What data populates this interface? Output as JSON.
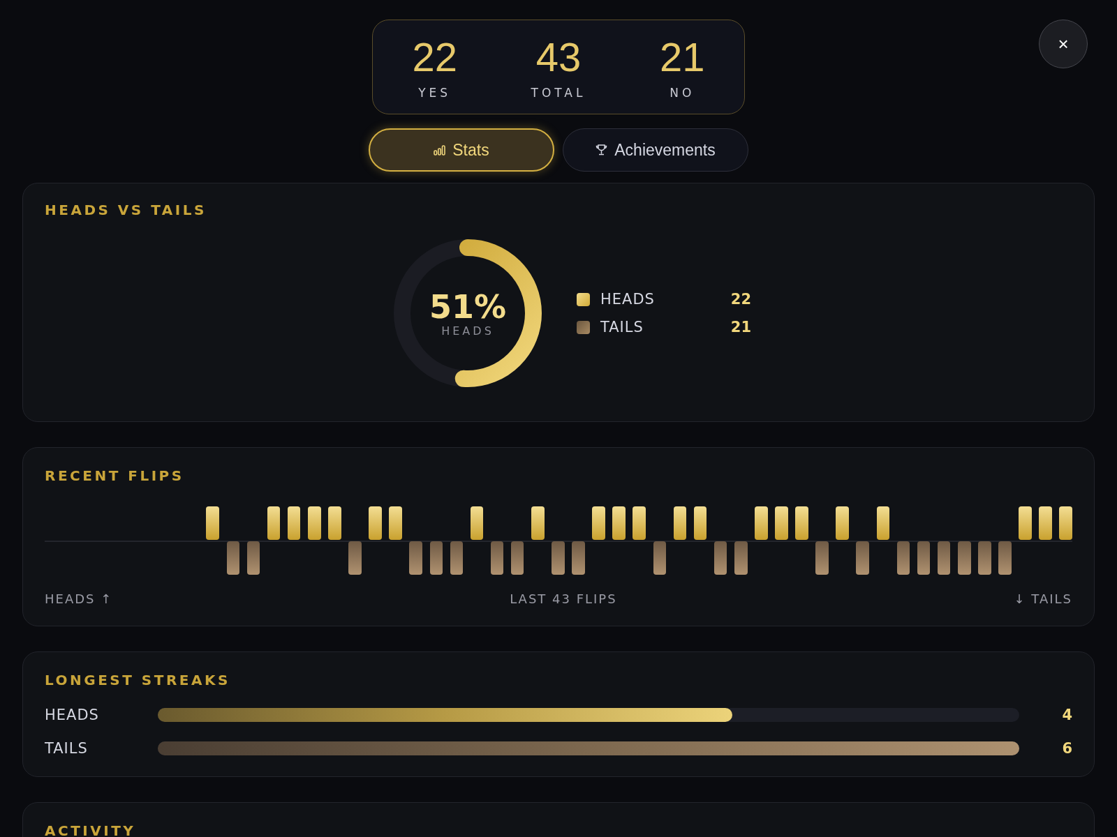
{
  "summary": [
    {
      "value": "22",
      "label": "YES"
    },
    {
      "value": "43",
      "label": "TOTAL"
    },
    {
      "value": "21",
      "label": "NO"
    }
  ],
  "tabs": [
    {
      "label": "Stats",
      "selected": true
    },
    {
      "label": "Achievements",
      "selected": false
    }
  ],
  "close": {
    "label": "×"
  },
  "heads_vs_tails": {
    "title": "HEADS VS TAILS",
    "donut": {
      "level": 0.51,
      "value": "51%",
      "caption": "HEADS"
    },
    "legend": [
      {
        "kind": "heads",
        "label": "HEADS",
        "count": "22"
      },
      {
        "kind": "tails",
        "label": "TAILS",
        "count": "21"
      }
    ]
  },
  "recent_flips": {
    "title": "RECENT FLIPS",
    "flips": [
      {
        "kind": "heads"
      },
      {
        "kind": "tails"
      },
      {
        "kind": "tails"
      },
      {
        "kind": "heads"
      },
      {
        "kind": "heads"
      },
      {
        "kind": "heads"
      },
      {
        "kind": "heads"
      },
      {
        "kind": "tails"
      },
      {
        "kind": "heads"
      },
      {
        "kind": "heads"
      },
      {
        "kind": "tails"
      },
      {
        "kind": "tails"
      },
      {
        "kind": "tails"
      },
      {
        "kind": "heads"
      },
      {
        "kind": "tails"
      },
      {
        "kind": "tails"
      },
      {
        "kind": "heads"
      },
      {
        "kind": "tails"
      },
      {
        "kind": "tails"
      },
      {
        "kind": "heads"
      },
      {
        "kind": "heads"
      },
      {
        "kind": "heads"
      },
      {
        "kind": "tails"
      },
      {
        "kind": "heads"
      },
      {
        "kind": "heads"
      },
      {
        "kind": "tails"
      },
      {
        "kind": "tails"
      },
      {
        "kind": "heads"
      },
      {
        "kind": "heads"
      },
      {
        "kind": "heads"
      },
      {
        "kind": "tails"
      },
      {
        "kind": "heads"
      },
      {
        "kind": "tails"
      },
      {
        "kind": "heads"
      },
      {
        "kind": "tails"
      },
      {
        "kind": "tails"
      },
      {
        "kind": "tails"
      },
      {
        "kind": "tails"
      },
      {
        "kind": "tails"
      },
      {
        "kind": "tails"
      },
      {
        "kind": "heads"
      },
      {
        "kind": "heads"
      },
      {
        "kind": "heads"
      }
    ],
    "left_label": "HEADS ↑",
    "center_label": "LAST 43 FLIPS",
    "right_label": "↓ TAILS"
  },
  "longest_streaks": {
    "title": "LONGEST STREAKS",
    "rows": [
      {
        "kind": "heads",
        "label": "HEADS",
        "level": 0.667,
        "value": "4"
      },
      {
        "kind": "tails",
        "label": "TAILS",
        "level": 1,
        "value": "6"
      }
    ]
  },
  "activity": {
    "title": "ACTIVITY"
  }
}
